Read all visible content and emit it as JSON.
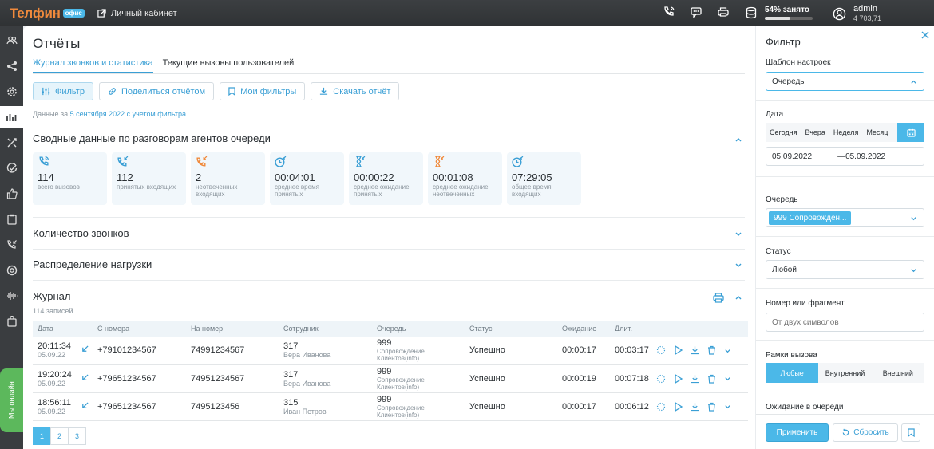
{
  "topbar": {
    "logo": "Телфин",
    "logo_badge": "офис",
    "cabinet_label": "Личный кабинет",
    "storage_label": "54% занято",
    "storage_fraction": 0.54,
    "user_name": "admin",
    "user_balance": "4 703,71",
    "icons": [
      "phone-call-icon",
      "chat-icon",
      "printer-icon",
      "database-icon",
      "user-icon"
    ]
  },
  "sidebar": {
    "items": [
      "users-icon",
      "network-icon",
      "settings-icon",
      "chart-icon",
      "routing-icon",
      "check-icon",
      "like-icon",
      "clipboard-icon",
      "incoming-call-icon",
      "headset-icon",
      "waveform-icon",
      "bag-icon"
    ],
    "online_label": "Мы онлайн"
  },
  "page": {
    "title": "Отчёты",
    "tabs": [
      "Журнал звонков и статистика",
      "Текущие вызовы пользователей"
    ],
    "toolbar": [
      "Фильтр",
      "Поделиться отчётом",
      "Мои фильтры",
      "Скачать отчёт"
    ],
    "dataline_prefix": "Данные за ",
    "dataline_link": "5 сентября 2022 с учетом фильтра"
  },
  "summary": {
    "title": "Сводные данные по разговорам агентов очереди",
    "stats": [
      {
        "value": "114",
        "label": "всего вызовов",
        "color": "#3a9fd5"
      },
      {
        "value": "112",
        "label": "принятых входящих",
        "color": "#3a9fd5"
      },
      {
        "value": "2",
        "label": "неотвеченных входящих",
        "color": "#f08a3c"
      },
      {
        "value": "00:04:01",
        "label": "среднее время принятых",
        "color": "#3a9fd5"
      },
      {
        "value": "00:00:22",
        "label": "среднее ожидание принятых",
        "color": "#3a9fd5"
      },
      {
        "value": "00:01:08",
        "label": "среднее ожидание неотвеченных",
        "color": "#f08a3c"
      },
      {
        "value": "07:29:05",
        "label": "общее время входящих",
        "color": "#3a9fd5"
      }
    ]
  },
  "sections": {
    "calls_count": "Количество звонков",
    "load": "Распределение нагрузки",
    "journal": "Журнал",
    "journal_count": "114 записей"
  },
  "table": {
    "headers": [
      "Дата",
      "С номера",
      "На номер",
      "Сотрудник",
      "Очередь",
      "Статус",
      "Ожидание",
      "Длит."
    ],
    "rows": [
      {
        "time": "20:11:34",
        "date": "05.09.22",
        "from": "+79101234567",
        "to": "74991234567",
        "emp": "317",
        "emp_name": "Вера Иванова",
        "queue": "999",
        "queue_name": "Сопровождение Клиентов(info)",
        "status": "Успешно",
        "wait": "00:00:17",
        "dur": "00:03:17"
      },
      {
        "time": "19:20:24",
        "date": "05.09.22",
        "from": "+79651234567",
        "to": "74951234567",
        "emp": "317",
        "emp_name": "Вера Иванова",
        "queue": "999",
        "queue_name": "Сопровождение Клиентов(info)",
        "status": "Успешно",
        "wait": "00:00:19",
        "dur": "00:07:18"
      },
      {
        "time": "18:56:11",
        "date": "05.09.22",
        "from": "+79651234567",
        "to": "7495123456",
        "emp": "315",
        "emp_name": "Иван Петров",
        "queue": "999",
        "queue_name": "Сопровождение Клиентов(info)",
        "status": "Успешно",
        "wait": "00:00:17",
        "dur": "00:06:12"
      }
    ],
    "pages": [
      "1",
      "2",
      "3"
    ]
  },
  "filter": {
    "title": "Фильтр",
    "template_label": "Шаблон настроек",
    "template_value": "Очередь",
    "date_label": "Дата",
    "date_quick": [
      "Сегодня",
      "Вчера",
      "Неделя",
      "Месяц"
    ],
    "date_from": "05.09.2022",
    "date_sep": "—",
    "date_to": "05.09.2022",
    "queue_label": "Очередь",
    "queue_value": "999 Сопровожден...",
    "status_label": "Статус",
    "status_value": "Любой",
    "number_label": "Номер или фрагмент",
    "number_placeholder": "От двух символов",
    "frames_label": "Рамки вызова",
    "frames": [
      "Любые",
      "Внутренний",
      "Внешний"
    ],
    "wait_label": "Ожидание в очереди",
    "apply": "Применить",
    "reset": "Сбросить"
  },
  "colors": {
    "accent": "#4bb8e8",
    "orange": "#f08a3c",
    "topbar": "#333638"
  }
}
